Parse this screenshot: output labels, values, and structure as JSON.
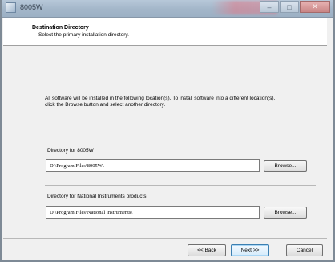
{
  "window": {
    "title": "8005W",
    "controls": {
      "minimize": "–",
      "maximize": "□",
      "close": "✕"
    }
  },
  "header": {
    "title": "Destination Directory",
    "subtitle": "Select the primary installation directory."
  },
  "body": {
    "description": "All software will be installed in the following location(s). To install software into a different location(s), click the Browse button and select another directory."
  },
  "directories": [
    {
      "label": "Directory for 8005W",
      "value": "D:\\Program Files\\8005W\\",
      "browse_label": "Browse..."
    },
    {
      "label": "Directory for National Instruments products",
      "value": "D:\\Program Files\\National Instruments\\",
      "browse_label": "Browse..."
    }
  ],
  "footer": {
    "back_label": "<< Back",
    "next_label": "Next >>",
    "cancel_label": "Cancel"
  },
  "icons": {
    "app": "installer-icon",
    "minimize": "minimize-icon",
    "maximize": "maximize-icon",
    "close": "close-icon"
  }
}
